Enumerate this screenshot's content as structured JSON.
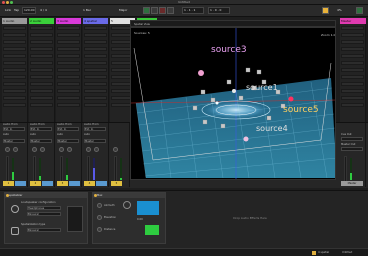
{
  "window": {
    "title": "Untitled"
  },
  "control_bar": {
    "link": "Link",
    "tap": "Tap",
    "tempo": "120.00",
    "time_sig": "4 / 4",
    "quantize": "1 Bar",
    "position": "1 . 1 . 1",
    "loop_length": "1 . 0 . 0",
    "key": "Major",
    "cpu": "4%"
  },
  "tracks": [
    {
      "name": "1 Audio",
      "color": "#9a9a9a",
      "type": "Audio From",
      "source": "Ext. In",
      "monitor": "Auto",
      "out": "Master",
      "num": "1"
    },
    {
      "name": "2 Audio",
      "color": "#3ad03a",
      "type": "Audio From",
      "source": "Ext. In",
      "monitor": "Auto",
      "out": "Master",
      "num": "2"
    },
    {
      "name": "3 Audio",
      "color": "#d93ad9",
      "type": "Audio From",
      "source": "Ext. In",
      "monitor": "Auto",
      "out": "Master",
      "num": "3"
    },
    {
      "name": "4 spatial",
      "color": "#6a6ae8",
      "type": "Audio From",
      "source": "Ext. In",
      "monitor": "Auto",
      "out": "Master",
      "num": "4"
    },
    {
      "name": "5",
      "color": "#e0e0e0",
      "type": "",
      "source": "",
      "monitor": "",
      "out": "",
      "num": "5"
    },
    {
      "name": "6",
      "color": "#3ac83a",
      "type": "",
      "source": "",
      "monitor": "",
      "out": "",
      "num": "6"
    },
    {
      "name": "7",
      "color": "#e03ab0",
      "type": "",
      "source": "",
      "monitor": "",
      "out": "",
      "num": "7"
    }
  ],
  "master": {
    "name": "Master",
    "color": "#9a9a9a",
    "cue_out": "Cue Out",
    "master_out": "Master Out",
    "sends": "Sends"
  },
  "viz": {
    "title": "Spatial View",
    "info": "Sources: 5",
    "info2": "Zoom 1.0",
    "labels": [
      "source3",
      "source1",
      "source5",
      "source4"
    ]
  },
  "devices": {
    "device1": {
      "title": "spatializer",
      "section_a": "Loudspeaker configuration",
      "opt_a": "Headphones",
      "opt_a2": "Binaural",
      "section_b": "Spatialization type",
      "opt_b": "Binaural"
    },
    "device2": {
      "title": "Max",
      "param_a": "Azimuth",
      "param_b": "Elevation",
      "param_c": "Distance",
      "value": "0.00"
    },
    "drop_hint": "Drop Audio Effects Here"
  },
  "status": {
    "track_name": "4 spatial",
    "cpu_info": "Untitled"
  }
}
